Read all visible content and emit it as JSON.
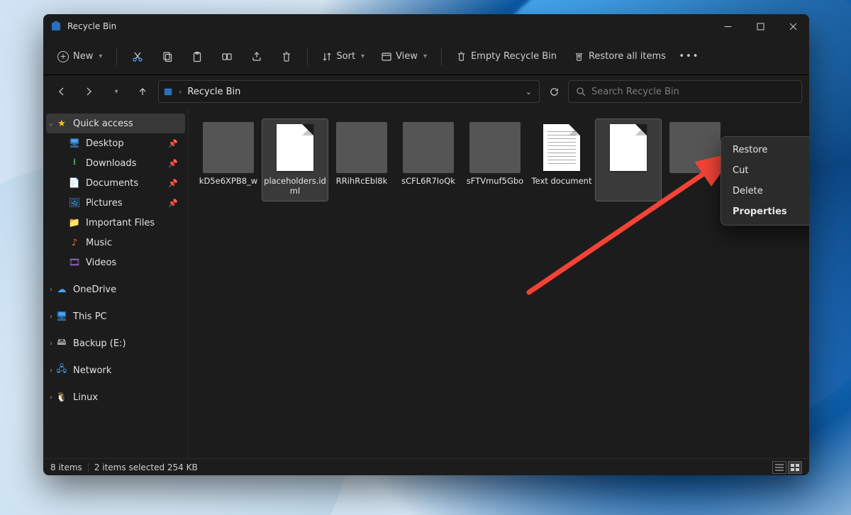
{
  "titlebar": {
    "title": "Recycle Bin"
  },
  "toolbar": {
    "new_label": "New",
    "sort_label": "Sort",
    "view_label": "View",
    "empty_label": "Empty Recycle Bin",
    "restore_all_label": "Restore all items"
  },
  "addressbar": {
    "location": "Recycle Bin"
  },
  "search": {
    "placeholder": "Search Recycle Bin"
  },
  "sidebar": {
    "quick_access": "Quick access",
    "quick_items": [
      {
        "label": "Desktop",
        "pin": true,
        "icon": "desktop"
      },
      {
        "label": "Downloads",
        "pin": true,
        "icon": "downloads"
      },
      {
        "label": "Documents",
        "pin": true,
        "icon": "documents"
      },
      {
        "label": "Pictures",
        "pin": true,
        "icon": "pictures"
      },
      {
        "label": "Important Files",
        "pin": false,
        "icon": "folder"
      },
      {
        "label": "Music",
        "pin": false,
        "icon": "music"
      },
      {
        "label": "Videos",
        "pin": false,
        "icon": "videos"
      }
    ],
    "roots": [
      {
        "label": "OneDrive",
        "icon": "cloud"
      },
      {
        "label": "This PC",
        "icon": "pc"
      },
      {
        "label": "Backup (E:)",
        "icon": "drive"
      },
      {
        "label": "Network",
        "icon": "network"
      },
      {
        "label": "Linux",
        "icon": "linux"
      }
    ]
  },
  "files": [
    {
      "name": "kD5e6XPB8_w",
      "kind": "image",
      "ph": "ph1",
      "selected": false
    },
    {
      "name": "placeholders.idml",
      "kind": "doc-blank",
      "selected": true
    },
    {
      "name": "RRihRcEbl8k",
      "kind": "image",
      "ph": "ph2",
      "selected": false
    },
    {
      "name": "sCFL6R7IoQk",
      "kind": "image",
      "ph": "ph3",
      "selected": false
    },
    {
      "name": "sFTVmuf5Gbo",
      "kind": "image",
      "ph": "ph4",
      "selected": false
    },
    {
      "name": "Text document",
      "kind": "doc-lines",
      "selected": false
    },
    {
      "name": "",
      "kind": "doc-blank",
      "selected": true
    },
    {
      "name": "",
      "kind": "image",
      "ph": "ph5",
      "selected": false
    }
  ],
  "context_menu": {
    "items": [
      {
        "label": "Restore",
        "bold": false
      },
      {
        "label": "Cut",
        "bold": false
      },
      {
        "label": "Delete",
        "bold": false
      },
      {
        "label": "Properties",
        "bold": true
      }
    ]
  },
  "statusbar": {
    "count_text": "8 items",
    "selection_text": "2 items selected  254 KB"
  }
}
